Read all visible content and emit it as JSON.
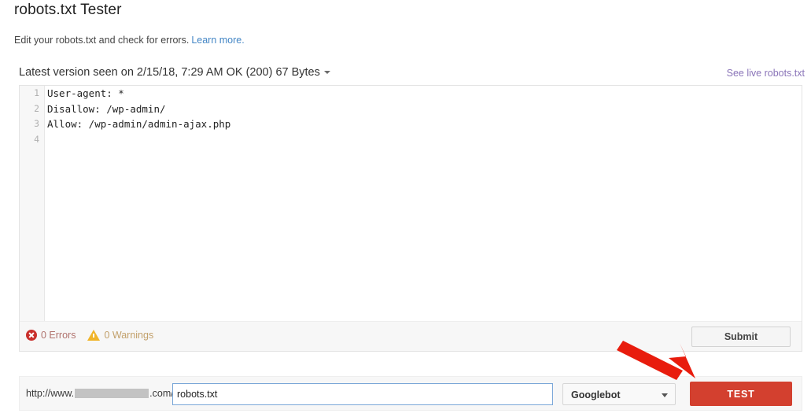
{
  "header": {
    "title": "robots.txt Tester",
    "subtitle": "Edit your robots.txt and check for errors.",
    "learn_more_label": "Learn more."
  },
  "version_row": {
    "label": "Latest version seen on 2/15/18, 7:29 AM OK (200) 67 Bytes",
    "see_live_label": "See live robots.txt"
  },
  "editor": {
    "line_numbers": [
      "1",
      "2",
      "3",
      "4"
    ],
    "lines": [
      "User-agent: *",
      "Disallow: /wp-admin/",
      "Allow: /wp-admin/admin-ajax.php",
      ""
    ]
  },
  "status_bar": {
    "errors_label": "0 Errors",
    "warnings_label": "0 Warnings",
    "error_icon": "error-circle-x-icon",
    "warning_icon": "warning-triangle-icon",
    "submit_label": "Submit"
  },
  "test_bar": {
    "url_scheme": "http://www.",
    "url_domain_redacted": "",
    "url_tld_path": ".com/",
    "url_input_value": "robots.txt",
    "url_input_placeholder": "",
    "bot_selected": "Googlebot",
    "bot_options": [
      "Googlebot"
    ],
    "test_label": "TEST"
  },
  "annotation": {
    "arrow_name": "red-arrow-pointing-to-test-button",
    "arrow_color": "#e81c0d"
  },
  "colors": {
    "accent_red": "#d3402f",
    "link_blue": "#4285c5",
    "link_visited_purple": "#8a74b8",
    "error_red": "#c9302c",
    "warning_amber": "#f0b429"
  }
}
